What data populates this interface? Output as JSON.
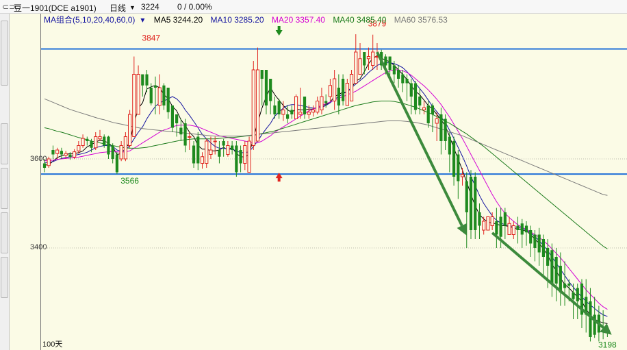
{
  "header": {
    "link_icon": "link-icon",
    "symbol": "豆一1901(DCE a1901)",
    "period": "日线",
    "dropdown_icon": "chevron-down-icon",
    "price": "3224",
    "change": "0 / 0.00%"
  },
  "legend": {
    "group": "MA组合(5,10,20,40,60,0)",
    "ma5": "MA5 3244.20",
    "ma10": "MA10 3285.20",
    "ma20": "MA20 3357.40",
    "ma40": "MA40 3485.40",
    "ma60": "MA60 3576.53"
  },
  "footer": {
    "period_count": "100天"
  },
  "colors": {
    "background": "#fbfbe6",
    "up": "#e0241f",
    "down": "#1e8a1e",
    "ma5": "#000000",
    "ma10": "#1414a0",
    "ma20": "#d400d4",
    "ma40": "#1a7a1a",
    "ma60": "#7a7a7a",
    "level_line": "#1e6fd8",
    "arrow": "#3c8a3c"
  },
  "chart_data": {
    "type": "candlestick",
    "y_ticks": [
      3600,
      3400
    ],
    "ylim": [
      3175,
      3900
    ],
    "grid": "horizontal dotted",
    "levels": [
      3847,
      3566
    ],
    "annotations": [
      {
        "text": "3847",
        "value": 3847,
        "index": 25
      },
      {
        "text": "3879",
        "value": 3879,
        "index": 78
      },
      {
        "text": "3566",
        "value": 3566,
        "index": 20
      },
      {
        "text": "3198",
        "value": 3198,
        "index": 132
      }
    ],
    "markers": [
      {
        "type": "down-arrow",
        "index": 55
      },
      {
        "type": "up-arrow",
        "index": 55
      }
    ],
    "trend_arrows": [
      {
        "from": [
          78,
          3840
        ],
        "to": [
          99,
          3428
        ]
      },
      {
        "from": [
          105,
          3434
        ],
        "to": [
          133,
          3205
        ]
      }
    ],
    "open": [
      3590,
      3585,
      3620,
      3612,
      3618,
      3608,
      3610,
      3604,
      3618,
      3630,
      3645,
      3640,
      3625,
      3645,
      3650,
      3650,
      3630,
      3610,
      3600,
      3600,
      3630,
      3650,
      3700,
      3790,
      3790,
      3760,
      3765,
      3720,
      3765,
      3760,
      3720,
      3700,
      3670,
      3680,
      3650,
      3630,
      3650,
      3590,
      3590,
      3610,
      3640,
      3620,
      3640,
      3610,
      3630,
      3630,
      3620,
      3590,
      3570,
      3630,
      3640,
      3800,
      3800,
      3780,
      3720,
      3730,
      3700,
      3700,
      3710,
      3690,
      3700,
      3740,
      3700,
      3705,
      3705,
      3710,
      3730,
      3740,
      3730,
      3760,
      3780,
      3720,
      3730,
      3770,
      3790,
      3840,
      3825,
      3810,
      3830,
      3840,
      3830,
      3830,
      3810,
      3800,
      3790,
      3780,
      3770,
      3770,
      3740,
      3710,
      3720,
      3720,
      3680,
      3700,
      3690,
      3650,
      3640,
      3610,
      3560,
      3550,
      3560,
      3560,
      3480,
      3440,
      3440,
      3450,
      3460,
      3470,
      3480,
      3430,
      3430,
      3450,
      3455,
      3450,
      3440,
      3430,
      3430,
      3420,
      3400,
      3395,
      3380,
      3360,
      3320,
      3320,
      3300,
      3310,
      3320,
      3290,
      3280,
      3250,
      3250,
      3200,
      3205
    ],
    "close": [
      3580,
      3600,
      3610,
      3620,
      3610,
      3612,
      3604,
      3616,
      3630,
      3646,
      3640,
      3625,
      3650,
      3650,
      3630,
      3610,
      3600,
      3570,
      3630,
      3650,
      3700,
      3790,
      3790,
      3765,
      3765,
      3725,
      3760,
      3760,
      3720,
      3705,
      3670,
      3680,
      3655,
      3630,
      3650,
      3590,
      3590,
      3605,
      3640,
      3620,
      3640,
      3605,
      3630,
      3630,
      3620,
      3570,
      3590,
      3630,
      3640,
      3800,
      3800,
      3780,
      3720,
      3730,
      3700,
      3700,
      3710,
      3690,
      3700,
      3740,
      3705,
      3700,
      3705,
      3710,
      3730,
      3740,
      3725,
      3765,
      3780,
      3720,
      3730,
      3770,
      3790,
      3840,
      3825,
      3810,
      3830,
      3840,
      3830,
      3810,
      3810,
      3800,
      3790,
      3780,
      3770,
      3770,
      3740,
      3710,
      3720,
      3715,
      3680,
      3700,
      3690,
      3640,
      3640,
      3610,
      3560,
      3550,
      3565,
      3480,
      3440,
      3440,
      3450,
      3460,
      3470,
      3470,
      3430,
      3425,
      3450,
      3455,
      3450,
      3440,
      3430,
      3435,
      3410,
      3400,
      3390,
      3380,
      3360,
      3320,
      3320,
      3300,
      3310,
      3315,
      3285,
      3280,
      3250,
      3250,
      3200,
      3205,
      3210
    ],
    "high": [
      3600,
      3605,
      3630,
      3625,
      3625,
      3618,
      3615,
      3622,
      3640,
      3655,
      3650,
      3645,
      3660,
      3665,
      3655,
      3652,
      3635,
      3615,
      3640,
      3660,
      3710,
      3830,
      3810,
      3790,
      3800,
      3770,
      3785,
      3790,
      3770,
      3740,
      3700,
      3700,
      3690,
      3690,
      3660,
      3640,
      3660,
      3615,
      3645,
      3650,
      3650,
      3640,
      3645,
      3640,
      3640,
      3640,
      3630,
      3640,
      3650,
      3820,
      3850,
      3800,
      3800,
      3760,
      3740,
      3735,
      3730,
      3720,
      3720,
      3745,
      3760,
      3720,
      3720,
      3720,
      3740,
      3760,
      3745,
      3780,
      3800,
      3790,
      3790,
      3780,
      3800,
      3880,
      3860,
      3830,
      3850,
      3879,
      3860,
      3845,
      3835,
      3830,
      3820,
      3810,
      3800,
      3790,
      3780,
      3775,
      3760,
      3730,
      3730,
      3725,
      3705,
      3715,
      3700,
      3660,
      3650,
      3620,
      3580,
      3570,
      3575,
      3570,
      3500,
      3470,
      3470,
      3480,
      3490,
      3490,
      3490,
      3470,
      3460,
      3470,
      3465,
      3460,
      3450,
      3440,
      3445,
      3430,
      3420,
      3410,
      3400,
      3390,
      3370,
      3330,
      3320,
      3320,
      3330,
      3330,
      3310,
      3290,
      3270,
      3260,
      3220
    ],
    "low": [
      3570,
      3580,
      3600,
      3600,
      3600,
      3600,
      3598,
      3600,
      3612,
      3625,
      3630,
      3615,
      3620,
      3640,
      3625,
      3600,
      3590,
      3566,
      3595,
      3595,
      3625,
      3650,
      3700,
      3740,
      3750,
      3720,
      3700,
      3700,
      3710,
      3690,
      3660,
      3650,
      3640,
      3615,
      3620,
      3580,
      3575,
      3578,
      3580,
      3600,
      3610,
      3590,
      3605,
      3605,
      3610,
      3560,
      3570,
      3575,
      3570,
      3620,
      3640,
      3720,
      3700,
      3700,
      3690,
      3690,
      3685,
      3680,
      3690,
      3690,
      3690,
      3690,
      3690,
      3695,
      3700,
      3700,
      3715,
      3730,
      3710,
      3700,
      3720,
      3720,
      3760,
      3800,
      3810,
      3790,
      3800,
      3800,
      3800,
      3800,
      3790,
      3780,
      3770,
      3760,
      3750,
      3730,
      3700,
      3700,
      3700,
      3700,
      3670,
      3660,
      3640,
      3610,
      3620,
      3570,
      3540,
      3510,
      3540,
      3400,
      3420,
      3420,
      3420,
      3430,
      3440,
      3440,
      3400,
      3400,
      3420,
      3430,
      3420,
      3410,
      3400,
      3405,
      3380,
      3370,
      3360,
      3340,
      3310,
      3290,
      3280,
      3270,
      3270,
      3280,
      3240,
      3240,
      3220,
      3210,
      3190,
      3198,
      3190,
      3195,
      3200
    ],
    "ma": {
      "ma5": [
        3586,
        3587,
        3595,
        3603,
        3607,
        3610,
        3612,
        3612,
        3614,
        3618,
        3627,
        3632,
        3638,
        3642,
        3640,
        3636,
        3627,
        3610,
        3612,
        3624,
        3637,
        3680,
        3714,
        3726,
        3757,
        3762,
        3765,
        3760,
        3745,
        3735,
        3718,
        3708,
        3688,
        3675,
        3660,
        3650,
        3630,
        3622,
        3622,
        3618,
        3618,
        3620,
        3626,
        3620,
        3626,
        3612,
        3605,
        3604,
        3610,
        3648,
        3682,
        3714,
        3740,
        3760,
        3744,
        3732,
        3720,
        3710,
        3705,
        3712,
        3710,
        3710,
        3712,
        3712,
        3716,
        3720,
        3722,
        3728,
        3740,
        3745,
        3750,
        3750,
        3760,
        3775,
        3780,
        3796,
        3814,
        3826,
        3832,
        3826,
        3822,
        3818,
        3810,
        3800,
        3790,
        3778,
        3764,
        3752,
        3744,
        3732,
        3720,
        3712,
        3700,
        3688,
        3674,
        3650,
        3624,
        3600,
        3575,
        3548,
        3520,
        3495,
        3475,
        3465,
        3458,
        3456,
        3454,
        3450,
        3450,
        3448,
        3445,
        3442,
        3440,
        3438,
        3430,
        3420,
        3410,
        3398,
        3384,
        3364,
        3348,
        3332,
        3318,
        3310,
        3300,
        3290,
        3280,
        3262,
        3250,
        3240,
        3235,
        3232,
        3230
      ],
      "ma10": [
        3592,
        3592,
        3594,
        3598,
        3601,
        3603,
        3605,
        3608,
        3610,
        3612,
        3615,
        3620,
        3625,
        3628,
        3630,
        3630,
        3628,
        3620,
        3617,
        3620,
        3630,
        3645,
        3660,
        3672,
        3690,
        3705,
        3718,
        3726,
        3730,
        3735,
        3740,
        3735,
        3725,
        3710,
        3698,
        3684,
        3670,
        3655,
        3645,
        3636,
        3628,
        3624,
        3624,
        3622,
        3622,
        3618,
        3614,
        3614,
        3616,
        3628,
        3640,
        3655,
        3668,
        3680,
        3696,
        3706,
        3714,
        3720,
        3722,
        3722,
        3720,
        3718,
        3716,
        3714,
        3714,
        3716,
        3720,
        3726,
        3734,
        3740,
        3746,
        3752,
        3760,
        3768,
        3776,
        3784,
        3794,
        3802,
        3810,
        3814,
        3816,
        3816,
        3814,
        3810,
        3805,
        3796,
        3784,
        3770,
        3758,
        3746,
        3732,
        3718,
        3706,
        3694,
        3682,
        3664,
        3646,
        3626,
        3606,
        3584,
        3560,
        3540,
        3518,
        3500,
        3486,
        3472,
        3462,
        3456,
        3452,
        3450,
        3448,
        3446,
        3444,
        3440,
        3434,
        3426,
        3416,
        3406,
        3394,
        3380,
        3366,
        3352,
        3338,
        3324,
        3312,
        3300,
        3290,
        3280,
        3272,
        3264,
        3256,
        3250,
        3246
      ],
      "ma20": [
        3596,
        3596,
        3597,
        3599,
        3600,
        3601,
        3602,
        3603,
        3604,
        3606,
        3608,
        3610,
        3612,
        3614,
        3615,
        3616,
        3617,
        3616,
        3615,
        3616,
        3618,
        3624,
        3630,
        3636,
        3642,
        3648,
        3654,
        3660,
        3665,
        3668,
        3672,
        3675,
        3676,
        3676,
        3676,
        3674,
        3672,
        3668,
        3664,
        3660,
        3656,
        3652,
        3650,
        3648,
        3646,
        3644,
        3642,
        3640,
        3638,
        3636,
        3636,
        3640,
        3646,
        3652,
        3660,
        3666,
        3672,
        3678,
        3684,
        3690,
        3696,
        3702,
        3708,
        3712,
        3716,
        3720,
        3724,
        3728,
        3732,
        3736,
        3740,
        3744,
        3748,
        3752,
        3758,
        3764,
        3770,
        3776,
        3782,
        3788,
        3794,
        3798,
        3800,
        3800,
        3798,
        3794,
        3788,
        3780,
        3772,
        3764,
        3755,
        3745,
        3734,
        3722,
        3708,
        3694,
        3678,
        3662,
        3646,
        3628,
        3610,
        3592,
        3574,
        3556,
        3538,
        3520,
        3504,
        3490,
        3478,
        3468,
        3460,
        3452,
        3446,
        3442,
        3436,
        3430,
        3424,
        3416,
        3408,
        3398,
        3388,
        3378,
        3366,
        3354,
        3342,
        3330,
        3318,
        3306,
        3296,
        3286,
        3276,
        3268,
        3262
      ],
      "ma40": [
        3670,
        3668,
        3665,
        3662,
        3660,
        3657,
        3654,
        3651,
        3648,
        3646,
        3643,
        3640,
        3638,
        3636,
        3634,
        3632,
        3630,
        3628,
        3626,
        3625,
        3624,
        3624,
        3624,
        3625,
        3626,
        3628,
        3630,
        3632,
        3634,
        3636,
        3638,
        3640,
        3642,
        3643,
        3644,
        3645,
        3645,
        3645,
        3645,
        3645,
        3645,
        3646,
        3647,
        3648,
        3648,
        3649,
        3650,
        3651,
        3652,
        3653,
        3655,
        3657,
        3659,
        3661,
        3663,
        3666,
        3669,
        3672,
        3675,
        3678,
        3681,
        3684,
        3687,
        3690,
        3693,
        3696,
        3699,
        3702,
        3705,
        3708,
        3711,
        3714,
        3717,
        3720,
        3722,
        3724,
        3726,
        3728,
        3729,
        3730,
        3730,
        3730,
        3729,
        3727,
        3725,
        3722,
        3719,
        3716,
        3712,
        3708,
        3704,
        3700,
        3695,
        3690,
        3685,
        3680,
        3674,
        3668,
        3662,
        3656,
        3649,
        3642,
        3635,
        3628,
        3620,
        3612,
        3604,
        3596,
        3588,
        3580,
        3572,
        3564,
        3556,
        3548,
        3540,
        3532,
        3524,
        3516,
        3508,
        3500,
        3492,
        3484,
        3476,
        3468,
        3460,
        3452,
        3444,
        3436,
        3428,
        3420,
        3412,
        3404,
        3398
      ],
      "ma60": [
        3735,
        3731,
        3727,
        3723,
        3719,
        3715,
        3711,
        3708,
        3705,
        3702,
        3699,
        3696,
        3693,
        3690,
        3688,
        3685,
        3682,
        3680,
        3678,
        3676,
        3674,
        3672,
        3670,
        3668,
        3667,
        3666,
        3665,
        3664,
        3663,
        3662,
        3661,
        3660,
        3659,
        3658,
        3657,
        3656,
        3655,
        3654,
        3653,
        3652,
        3651,
        3651,
        3651,
        3651,
        3651,
        3651,
        3651,
        3652,
        3653,
        3654,
        3655,
        3656,
        3657,
        3658,
        3659,
        3660,
        3661,
        3662,
        3663,
        3664,
        3665,
        3666,
        3667,
        3668,
        3669,
        3670,
        3671,
        3672,
        3673,
        3674,
        3675,
        3676,
        3677,
        3678,
        3679,
        3680,
        3681,
        3682,
        3683,
        3684,
        3685,
        3686,
        3686,
        3686,
        3685,
        3684,
        3683,
        3682,
        3680,
        3678,
        3676,
        3673,
        3670,
        3667,
        3664,
        3661,
        3658,
        3655,
        3652,
        3648,
        3644,
        3640,
        3636,
        3632,
        3628,
        3624,
        3620,
        3616,
        3612,
        3608,
        3604,
        3600,
        3596,
        3592,
        3588,
        3584,
        3580,
        3576,
        3572,
        3568,
        3564,
        3560,
        3556,
        3552,
        3548,
        3544,
        3540,
        3536,
        3532,
        3528,
        3524,
        3520,
        3518
      ]
    }
  }
}
